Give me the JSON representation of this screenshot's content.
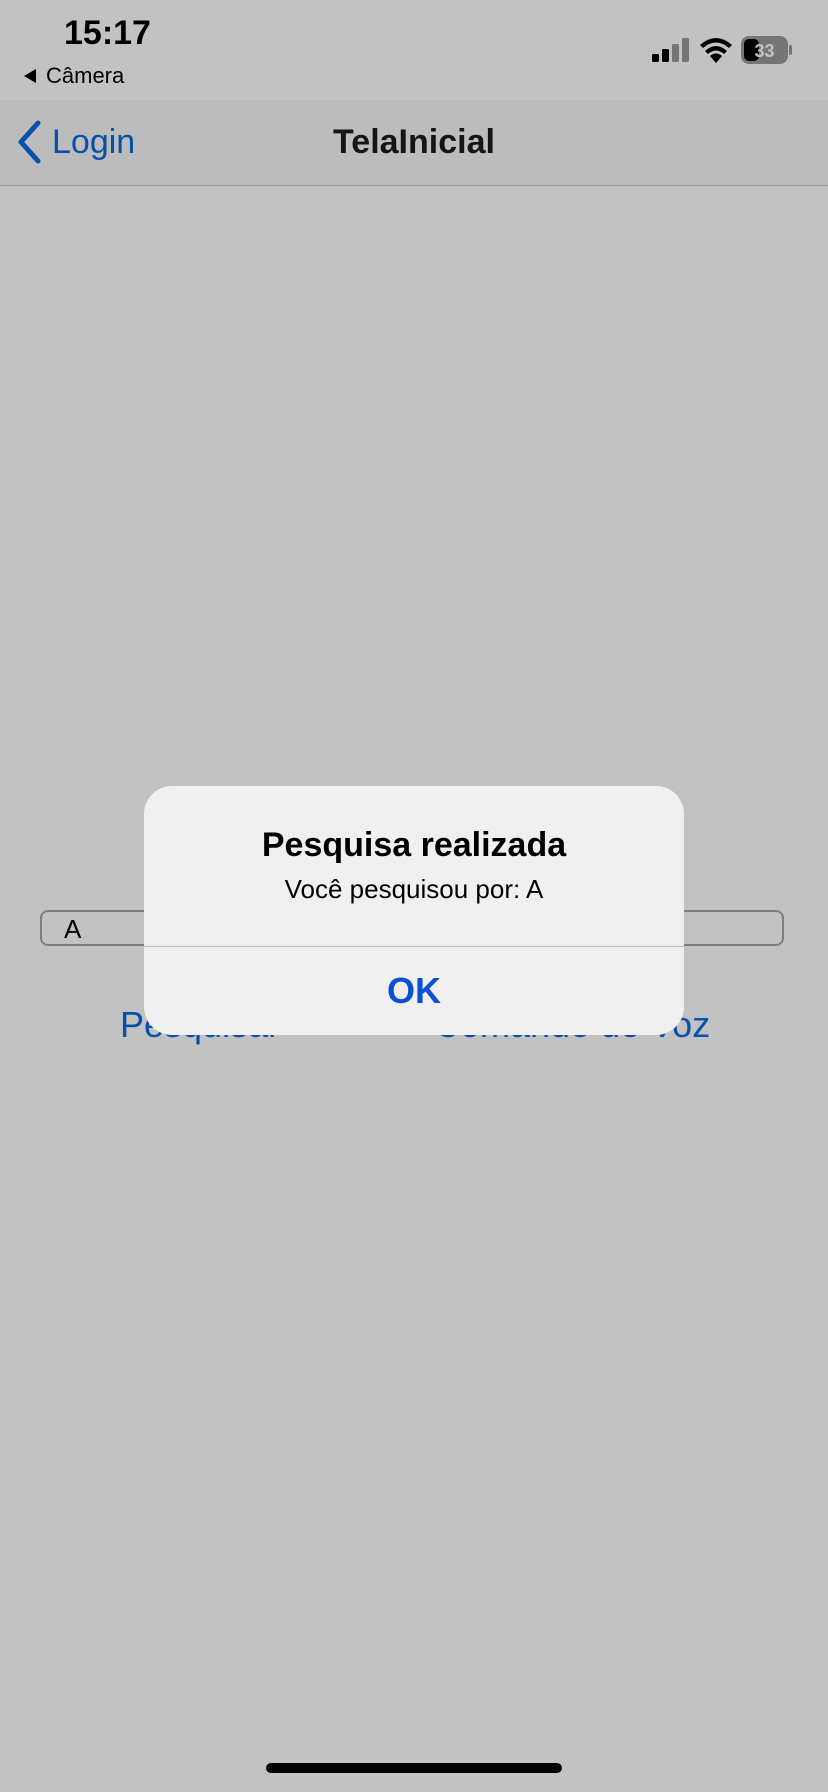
{
  "status_bar": {
    "time": "15:17",
    "back_app_label": "Câmera",
    "battery_level": "33",
    "icons": [
      "cellular-signal-icon",
      "wifi-icon",
      "battery-icon"
    ]
  },
  "navbar": {
    "back_label": "Login",
    "title": "TelaInicial"
  },
  "content": {
    "search_value": "A",
    "search_button_label": "Pesquisar",
    "voice_button_label": "Comando de Voz"
  },
  "alert": {
    "title": "Pesquisa realizada",
    "message": "Você pesquisou por: A",
    "ok_label": "OK"
  },
  "colors": {
    "accent": "#0a6be0",
    "alert_button": "#0a4fd6",
    "alert_background": "#f0f0f0"
  }
}
